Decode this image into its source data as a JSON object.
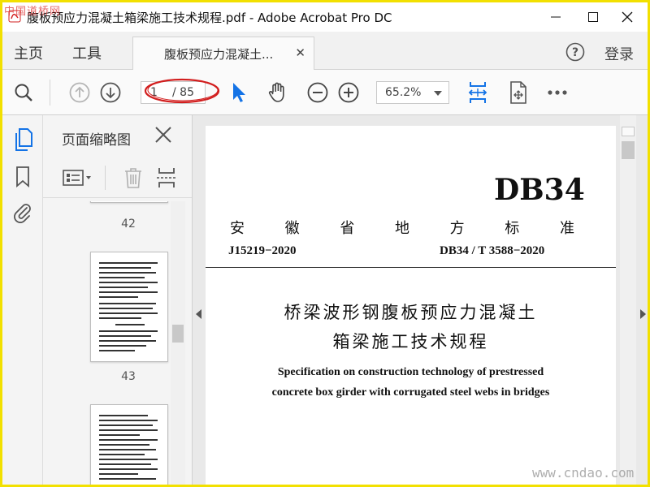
{
  "window": {
    "title": "腹板预应力混凝土箱梁施工技术规程.pdf - Adobe Acrobat Pro DC",
    "watermark_top_left": "中国道桥网",
    "watermark_bottom_right": "www.cndao.com"
  },
  "nav": {
    "home": "主页",
    "tools": "工具",
    "doc_tab": "腹板预应力混凝土...",
    "login": "登录"
  },
  "toolbar": {
    "current_page": "1",
    "total_pages": "/ 85",
    "zoom": "65.2%"
  },
  "thumbnails": {
    "title": "页面缩略图",
    "pages": [
      "42",
      "43"
    ]
  },
  "document": {
    "code_big": "DB34",
    "province_chars": [
      "安",
      "徽",
      "省",
      "地",
      "方",
      "标",
      "准"
    ],
    "record_no": "J15219−2020",
    "std_no": "DB34 / T  3588−2020",
    "title_cn_line1": "桥梁波形钢腹板预应力混凝土",
    "title_cn_line2": "箱梁施工技术规程",
    "title_en_line1": "Specification on construction technology of prestressed",
    "title_en_line2": "concrete box girder with corrugated steel webs in bridges"
  },
  "colors": {
    "frame_border": "#f2e000",
    "accent_blue": "#1473e6",
    "annotation_red": "#d21f1f"
  }
}
